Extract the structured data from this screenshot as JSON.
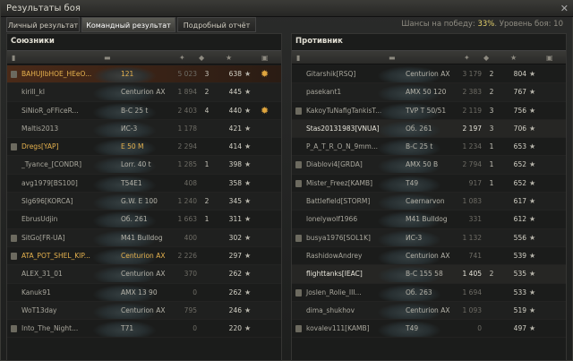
{
  "window": {
    "title": "Результаты боя",
    "close": "✕"
  },
  "tabs": [
    "Личный результат",
    "Командный результат",
    "Подробный отчёт"
  ],
  "chance": {
    "label": "Шансы на победу: ",
    "value": "33%",
    "level": ". Уровень боя: 10"
  },
  "allies": {
    "title": "Союзники",
    "rows": [
      {
        "name": "BAHUJlbHOE_HEeO...",
        "vehicle": "121",
        "damage": "5 023",
        "kills": "3",
        "points": "638",
        "medal": true,
        "badge": true,
        "me": true
      },
      {
        "name": "kirill_kl",
        "vehicle": "Centurion AX",
        "damage": "1 894",
        "kills": "2",
        "points": "445"
      },
      {
        "name": "SiNioR_oFFiceR...",
        "vehicle": "B-C 25 t",
        "damage": "2 403",
        "kills": "4",
        "points": "440",
        "medal": true
      },
      {
        "name": "Maltis2013",
        "vehicle": "ИС-3",
        "damage": "1 178",
        "kills": "",
        "points": "421"
      },
      {
        "name": "Dregs[YAP]",
        "vehicle": "E 50 M",
        "damage": "2 294",
        "kills": "",
        "points": "414",
        "badge": true,
        "gold": true
      },
      {
        "name": "_Tyance_[CONDR]",
        "vehicle": "Lorr. 40 t",
        "damage": "1 285",
        "kills": "1",
        "points": "398"
      },
      {
        "name": "avg1979[BS100]",
        "vehicle": "T54E1",
        "damage": "408",
        "kills": "",
        "points": "358"
      },
      {
        "name": "Slg696[KORCA]",
        "vehicle": "G.W. E 100",
        "damage": "1 240",
        "kills": "2",
        "points": "345"
      },
      {
        "name": "EbrusUdjin",
        "vehicle": "Об. 261",
        "damage": "1 663",
        "kills": "1",
        "points": "311"
      },
      {
        "name": "SitGo[FR-UA]",
        "vehicle": "M41 Bulldog",
        "damage": "400",
        "kills": "",
        "points": "302",
        "badge": true
      },
      {
        "name": "ATA_POT_SHEL_KIP...",
        "vehicle": "Centurion AX",
        "damage": "2 226",
        "kills": "",
        "points": "297",
        "badge": true,
        "gold": true
      },
      {
        "name": "ALEX_31_01",
        "vehicle": "Centurion AX",
        "damage": "370",
        "kills": "",
        "points": "262"
      },
      {
        "name": "Kanuk91",
        "vehicle": "AMX 13 90",
        "damage": "0",
        "kills": "",
        "points": "262"
      },
      {
        "name": "WoT13day",
        "vehicle": "Centurion AX",
        "damage": "795",
        "kills": "",
        "points": "246"
      },
      {
        "name": "Into_The_Night...",
        "vehicle": "T71",
        "damage": "0",
        "kills": "",
        "points": "220",
        "badge": true
      }
    ]
  },
  "enemies": {
    "title": "Противник",
    "rows": [
      {
        "name": "Gitarshik[RSQ]",
        "vehicle": "Centurion AX",
        "damage": "3 179",
        "kills": "2",
        "points": "804"
      },
      {
        "name": "pasekant1",
        "vehicle": "AMX 50 120",
        "damage": "2 383",
        "kills": "2",
        "points": "767"
      },
      {
        "name": "KakoyTuNafigTankisT...",
        "vehicle": "TVP T 50/51",
        "damage": "2 119",
        "kills": "3",
        "points": "756",
        "badge": true
      },
      {
        "name": "Stas20131983[VNUA]",
        "vehicle": "Об. 261",
        "damage": "2 197",
        "kills": "3",
        "points": "706",
        "white": true
      },
      {
        "name": "P_A_T_R_O_N_9mm...",
        "vehicle": "B-C 25 t",
        "damage": "1 234",
        "kills": "1",
        "points": "653"
      },
      {
        "name": "Diablovi4[GRDA]",
        "vehicle": "AMX 50 B",
        "damage": "2 794",
        "kills": "1",
        "points": "652",
        "badge": true
      },
      {
        "name": "Mister_Freez[KAMB]",
        "vehicle": "T49",
        "damage": "917",
        "kills": "1",
        "points": "652",
        "badge": true
      },
      {
        "name": "Battlefield[STORM]",
        "vehicle": "Caernarvon",
        "damage": "1 083",
        "kills": "",
        "points": "617"
      },
      {
        "name": "lonelywolf1966",
        "vehicle": "M41 Bulldog",
        "damage": "331",
        "kills": "",
        "points": "612"
      },
      {
        "name": "busya1976[SOL1K]",
        "vehicle": "ИС-3",
        "damage": "1 132",
        "kills": "",
        "points": "556",
        "badge": true
      },
      {
        "name": "RashidowAndrey",
        "vehicle": "Centurion AX",
        "damage": "741",
        "kills": "",
        "points": "539"
      },
      {
        "name": "flighttanks[IEAC]",
        "vehicle": "B-C 155 58",
        "damage": "1 405",
        "kills": "2",
        "points": "535",
        "white": true
      },
      {
        "name": "Joslen_Rolie_III...",
        "vehicle": "Об. 263",
        "damage": "1 694",
        "kills": "",
        "points": "533",
        "badge": true
      },
      {
        "name": "dima_shukhov",
        "vehicle": "Centurion AX",
        "damage": "1 093",
        "kills": "",
        "points": "519"
      },
      {
        "name": "kovalev111[KAMB]",
        "vehicle": "T49",
        "damage": "0",
        "kills": "",
        "points": "497",
        "badge": true
      }
    ]
  }
}
